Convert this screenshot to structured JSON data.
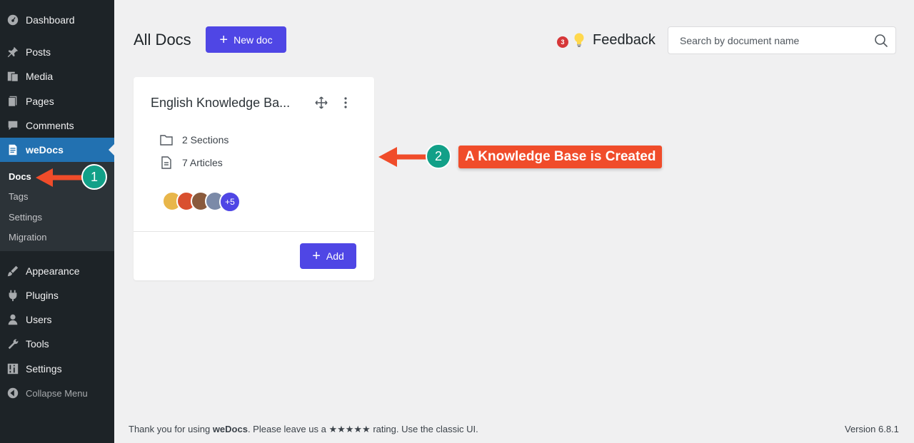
{
  "sidebar": {
    "items": [
      {
        "label": "Dashboard",
        "icon": "dashboard-icon"
      },
      {
        "label": "Posts",
        "icon": "pin-icon"
      },
      {
        "label": "Media",
        "icon": "media-icon"
      },
      {
        "label": "Pages",
        "icon": "pages-icon"
      },
      {
        "label": "Comments",
        "icon": "comment-icon"
      },
      {
        "label": "weDocs",
        "icon": "document-icon",
        "active": true
      },
      {
        "label": "Appearance",
        "icon": "brush-icon"
      },
      {
        "label": "Plugins",
        "icon": "plugin-icon"
      },
      {
        "label": "Users",
        "icon": "user-icon"
      },
      {
        "label": "Tools",
        "icon": "wrench-icon"
      },
      {
        "label": "Settings",
        "icon": "settings-icon"
      }
    ],
    "submenu": [
      "Docs",
      "Tags",
      "Settings",
      "Migration"
    ],
    "collapse_label": "Collapse Menu"
  },
  "header": {
    "title": "All Docs",
    "new_doc_label": "New doc",
    "feedback_label": "Feedback",
    "feedback_badge": "3",
    "search_placeholder": "Search by document name"
  },
  "card": {
    "title": "English Knowledge Ba...",
    "sections": "2 Sections",
    "articles": "7 Articles",
    "more_contributors": "+5",
    "add_label": "Add"
  },
  "annotations": {
    "marker_1": "1",
    "marker_2": "2",
    "callout": "A Knowledge Base is Created"
  },
  "footer": {
    "thanks_prefix": "Thank you for using",
    "brand": "weDocs",
    "thanks_mid": ". Please leave us a",
    "stars": "★★★★★",
    "thanks_suffix": "rating. Use the classic UI.",
    "version": "Version 6.8.1"
  },
  "colors": {
    "sidebar_bg": "#1d2327",
    "active_bg": "#2271b1",
    "primary": "#4f46e5",
    "marker": "#12a088",
    "callout": "#f04c2a"
  }
}
